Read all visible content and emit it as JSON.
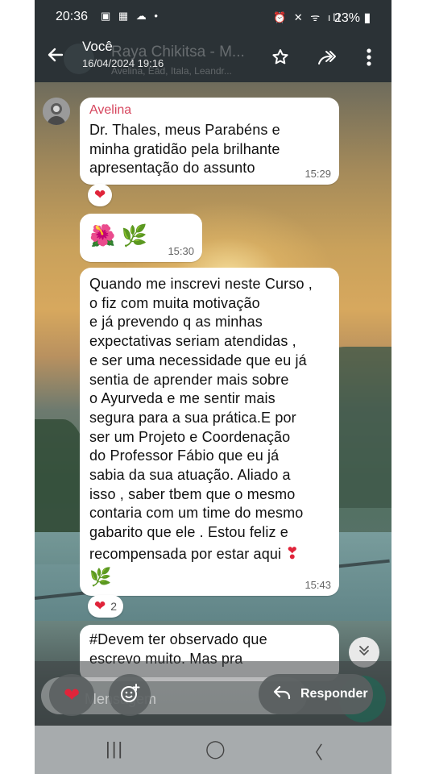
{
  "status_bar": {
    "time": "20:36",
    "left_icons": "▣ ▦ ☁ •",
    "right_icons": "⏰ ✕ ᯤ ıll",
    "battery": "23%"
  },
  "header": {
    "name": "Você",
    "subtitle": "16/04/2024 19:16",
    "ghost_title": "Raya Chikitsa - M...",
    "ghost_subtitle": "Avelina, Eād, Itala, Leandr..."
  },
  "messages": [
    {
      "sender": "Avelina",
      "lines": [
        "Dr. Thales, meus Parabéns e",
        "minha gratidão pela brilhante",
        "apresentação do assunto"
      ],
      "time": "15:29",
      "reaction": {
        "emoji": "❤",
        "count": ""
      }
    },
    {
      "emoji_text": "🌺 🌿",
      "time": "15:30"
    },
    {
      "lines": [
        "Quando me inscrevi neste Curso ,",
        "o fiz com muita motivação",
        "e já prevendo q as minhas",
        "expectativas seriam atendidas ,",
        "e ser uma necessidade que eu já",
        "sentia de aprender mais sobre",
        "o Ayurveda e me sentir mais",
        "segura para a sua prática.E por",
        "ser um Projeto e Coordenação",
        "do Professor Fábio que eu já",
        "sabia da sua atuação. Aliado a",
        "isso , saber tbem que o mesmo",
        "contaria com um time do mesmo",
        "gabarito que ele . Estou feliz  e",
        "recompensada por estar aqui"
      ],
      "trailing_emoji": "❣",
      "herb": "🌿",
      "time": "15:43",
      "reaction": {
        "emoji": "❤",
        "count": "2"
      }
    },
    {
      "lines": [
        "#Devem ter observado que",
        "escrevo muito. Mas pra"
      ]
    }
  ],
  "composer": {
    "placeholder": "Mensagem",
    "reply_label": "Responder"
  },
  "nav": {
    "recents": "|||",
    "home": "◯",
    "back": "〈"
  },
  "colors": {
    "header": "#2b3236",
    "sender": "#d6455d",
    "heart": "#e0243a"
  }
}
